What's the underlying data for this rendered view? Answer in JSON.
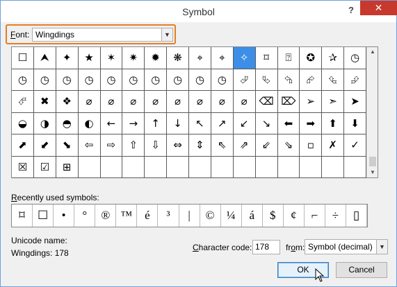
{
  "title": "Symbol",
  "help_label": "?",
  "close_label": "✕",
  "font": {
    "label_access": "F",
    "label_rest": "ont:",
    "value": "Wingdings"
  },
  "symbols": [
    "☐",
    "⮝",
    "✦",
    "★",
    "✶",
    "✷",
    "✹",
    "❋",
    "⌖",
    "⌖",
    "✧",
    "⌑",
    "⍰",
    "✪",
    "✰",
    "◷",
    "◷",
    "◷",
    "◷",
    "◷",
    "◷",
    "◷",
    "◷",
    "◷",
    "◷",
    "◷",
    "⮰",
    "⮱",
    "⮲",
    "⮳",
    "⮴",
    "⮵",
    "⮶",
    "✖",
    "❖",
    "⌀",
    "⌀",
    "⌀",
    "⌀",
    "⌀",
    "⌀",
    "⌀",
    "⌀",
    "⌫",
    "⌦",
    "➢",
    "➣",
    "➤",
    "◒",
    "◑",
    "◓",
    "◐",
    "←",
    "→",
    "↑",
    "↓",
    "↖",
    "↗",
    "↙",
    "↘",
    "⬅",
    "➡",
    "⬆",
    "⬇",
    "⬈",
    "⬋",
    "⬊",
    "⇦",
    "⇨",
    "⇧",
    "⇩",
    "⇔",
    "⇕",
    "⇖",
    "⇗",
    "⇙",
    "⇘",
    "▫",
    "✗",
    "✓",
    "☒",
    "☑",
    "⊞"
  ],
  "selected_index": 10,
  "recent": {
    "label_access": "R",
    "label_rest": "ecently used symbols:",
    "items": [
      "⌑",
      "☐",
      "•",
      "°",
      "®",
      "™",
      "é",
      "³",
      "|",
      "©",
      "¼",
      "á",
      "$",
      "¢",
      "⌐",
      "÷",
      "▯"
    ]
  },
  "unicode_name_label": "Unicode name:",
  "unicode_name_value": "Wingdings: 178",
  "char_code": {
    "label_access": "C",
    "label_rest": "haracter code:",
    "value": "178"
  },
  "from": {
    "label_pre": "fr",
    "label_access": "o",
    "label_rest": "m:",
    "value": "Symbol (decimal)"
  },
  "ok_label": "OK",
  "cancel_label": "Cancel"
}
